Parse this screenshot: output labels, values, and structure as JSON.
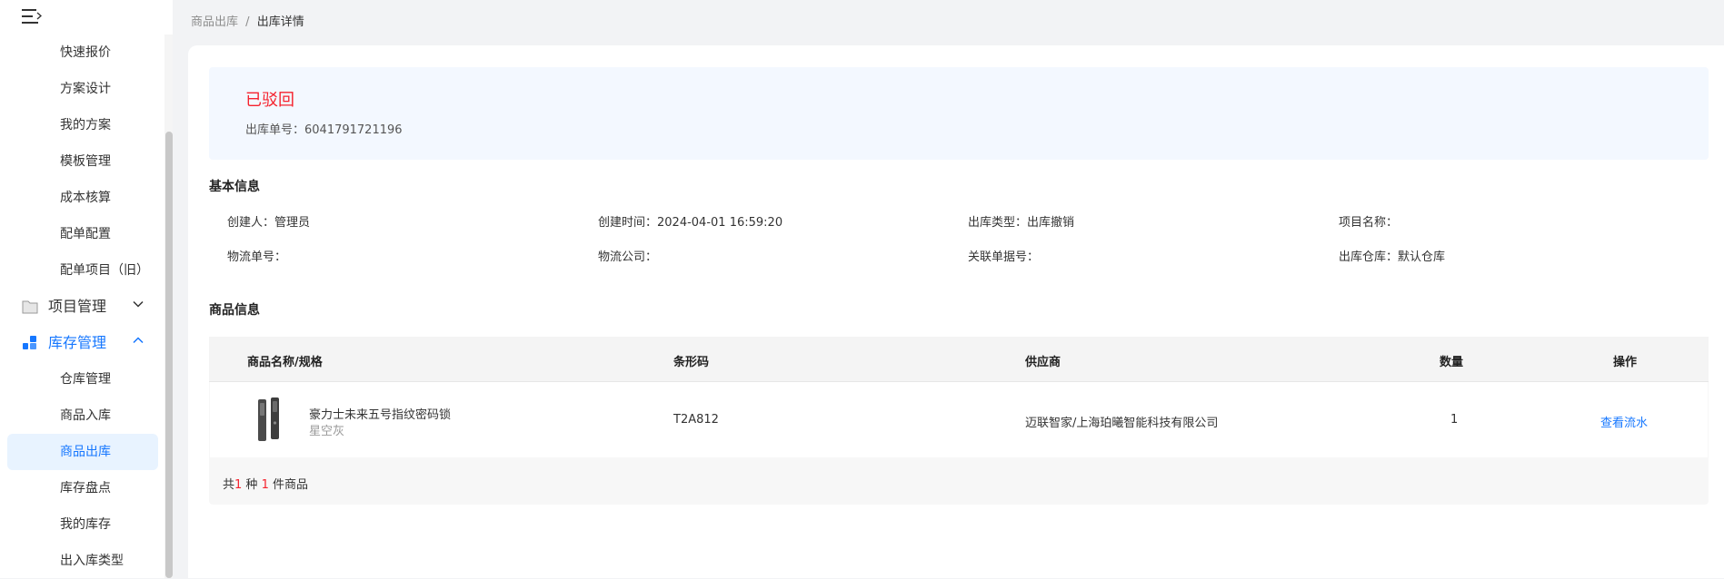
{
  "sidebar": {
    "items_top": [
      {
        "label": "快速报价"
      },
      {
        "label": "方案设计"
      },
      {
        "label": "我的方案"
      },
      {
        "label": "模板管理"
      },
      {
        "label": "成本核算"
      },
      {
        "label": "配单配置"
      },
      {
        "label": "配单项目（旧）"
      }
    ],
    "group_project": {
      "label": "项目管理",
      "icon": "folder-icon"
    },
    "group_inventory": {
      "label": "库存管理",
      "icon": "grid-icon"
    },
    "items_inventory": [
      {
        "label": "仓库管理"
      },
      {
        "label": "商品入库"
      },
      {
        "label": "商品出库",
        "active": true
      },
      {
        "label": "库存盘点"
      },
      {
        "label": "我的库存"
      },
      {
        "label": "出入库类型"
      }
    ],
    "accent_color": "#1677ff"
  },
  "breadcrumb": {
    "parent": "商品出库",
    "separator": "/",
    "current": "出库详情"
  },
  "status": {
    "title": "已驳回",
    "order_no_label": "出库单号：",
    "order_no": "6041791721196"
  },
  "basic_info": {
    "title": "基本信息",
    "creator_label": "创建人：",
    "creator": "管理员",
    "created_time_label": "创建时间：",
    "created_time": "2024-04-01 16:59:20",
    "type_label": "出库类型：",
    "type": "出库撤销",
    "project_label": "项目名称：",
    "project": "",
    "logistics_no_label": "物流单号：",
    "logistics_no": "",
    "logistics_company_label": "物流公司：",
    "logistics_company": "",
    "related_no_label": "关联单据号：",
    "related_no": "",
    "warehouse_label": "出库仓库：",
    "warehouse": "默认仓库"
  },
  "goods_info": {
    "title": "商品信息",
    "columns": [
      "商品名称/规格",
      "条形码",
      "供应商",
      "数量",
      "操作"
    ],
    "rows": [
      {
        "name": "豪力士未来五号指纹密码锁",
        "spec": "星空灰",
        "barcode": "T2A812",
        "supplier": "迈联智家/上海珀曦智能科技有限公司",
        "quantity": "1",
        "action": "查看流水"
      }
    ],
    "summary_prefix": "共",
    "summary_kinds": "1",
    "summary_mid": " 种 ",
    "summary_count": "1",
    "summary_suffix": " 件商品"
  }
}
